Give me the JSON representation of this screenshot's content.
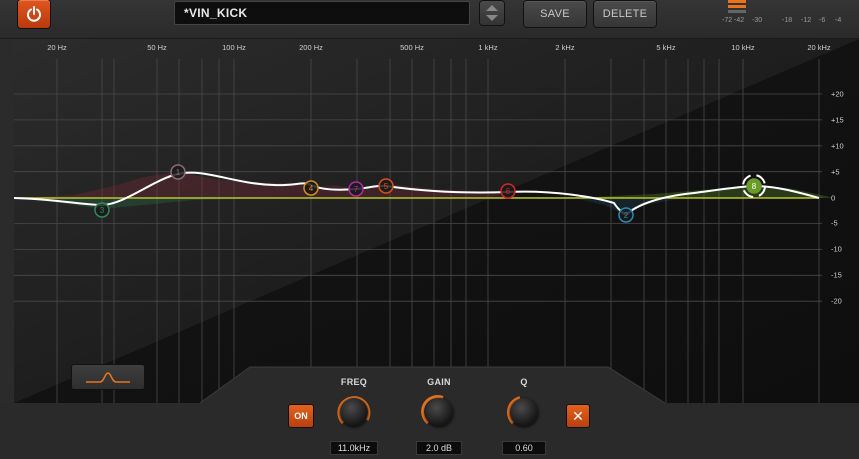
{
  "colors": {
    "accent": "#e8741f",
    "grid": "#4a4a4a",
    "curve": "#ffffff",
    "band_line": "#b5c32a"
  },
  "toolbar": {
    "power_icon": "power-icon",
    "preset_name": "*VIN_KICK",
    "save_label": "SAVE",
    "delete_label": "DELETE"
  },
  "meter": {
    "scale": [
      "-72",
      "-42",
      "-30",
      "-18",
      "-12",
      "-6",
      "-4"
    ]
  },
  "graph": {
    "freq_labels": [
      "20 Hz",
      "50 Hz",
      "100 Hz",
      "200 Hz",
      "500 Hz",
      "1 kHz",
      "2 kHz",
      "5 kHz",
      "10 kHz",
      "20 kHz"
    ],
    "db_labels": [
      "+20",
      "+15",
      "+10",
      "+5",
      "0",
      "-5",
      "-10",
      "-15",
      "-20"
    ],
    "bands": [
      {
        "id": "1",
        "color": "#8a6a78"
      },
      {
        "id": "2",
        "color": "#2a8ab8"
      },
      {
        "id": "3",
        "color": "#2f8a5a"
      },
      {
        "id": "4",
        "color": "#d88c1e"
      },
      {
        "id": "5",
        "color": "#d8501e"
      },
      {
        "id": "6",
        "color": "#d02828"
      },
      {
        "id": "7",
        "color": "#b02aa8"
      },
      {
        "id": "8",
        "color": "#6a9a2a"
      }
    ]
  },
  "band_panel": {
    "shape_icon": "bell-curve-icon",
    "on_label": "ON",
    "close_icon": "close-icon",
    "freq": {
      "label": "FREQ",
      "value": "11.0kHz"
    },
    "gain": {
      "label": "GAIN",
      "value": "2.0 dB"
    },
    "q": {
      "label": "Q",
      "value": "0.60"
    }
  }
}
